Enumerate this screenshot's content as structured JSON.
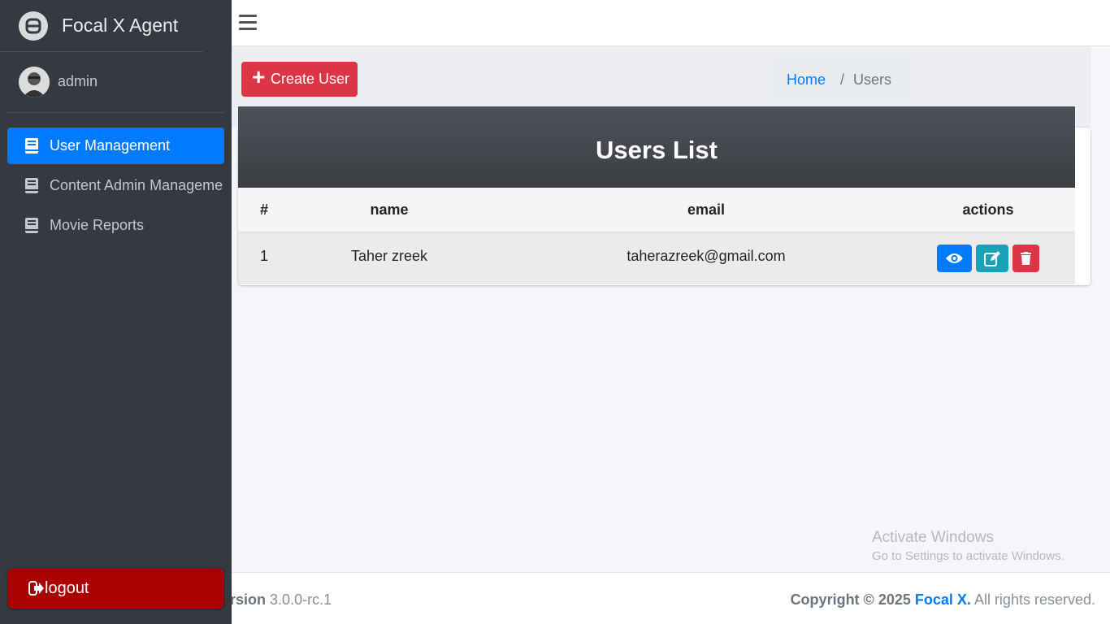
{
  "sidebar": {
    "brand": "Focal X Agent",
    "user": "admin",
    "items": [
      {
        "label": "User Management",
        "active": true
      },
      {
        "label": "Content Admin Manageme",
        "active": false
      },
      {
        "label": "Movie Reports",
        "active": false
      }
    ],
    "logout": "logout"
  },
  "header": {
    "create_button": "Create User",
    "breadcrumb": {
      "home": "Home",
      "separator": "/",
      "current": "Users"
    }
  },
  "card": {
    "title": "Users List",
    "columns": [
      "#",
      "name",
      "email",
      "actions"
    ],
    "rows": [
      {
        "id": "1",
        "name": "Taher zreek",
        "email": "taherazreek@gmail.com"
      }
    ]
  },
  "watermark": {
    "line1": "Activate Windows",
    "line2": "Go to Settings to activate Windows."
  },
  "footer": {
    "version_label": "ersion",
    "version_value": "3.0.0-rc.1",
    "copyright_prefix": "Copyright © 2025",
    "copyright_brand": "Focal X.",
    "copyright_suffix": "All rights reserved."
  },
  "colors": {
    "sidebar": "#343a40",
    "active": "#007bff",
    "danger": "#dc3545",
    "logout": "#a90000",
    "info": "#17a2b8"
  }
}
